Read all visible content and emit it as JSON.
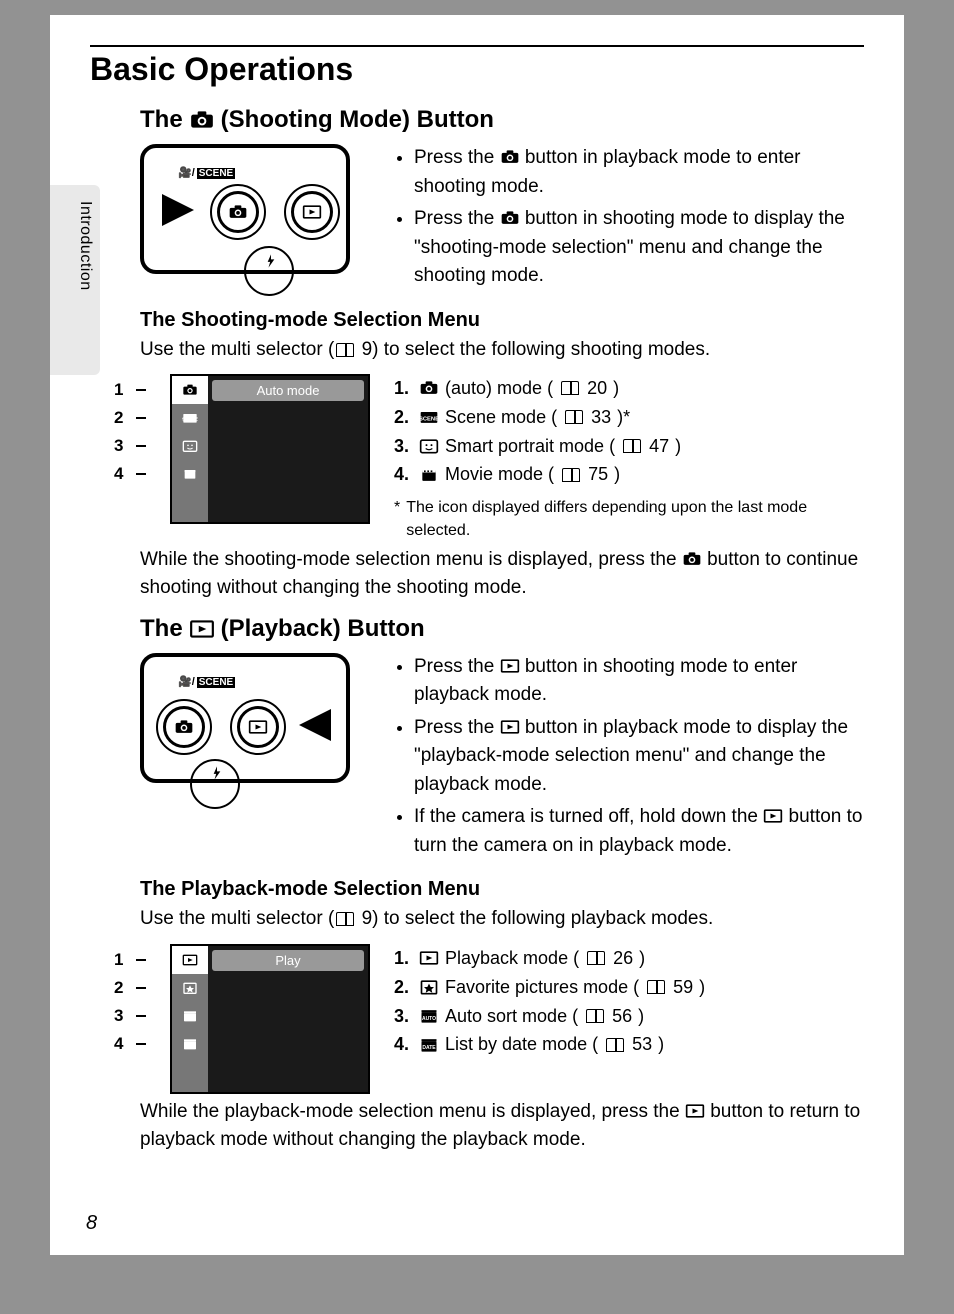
{
  "sideTab": "Introduction",
  "pageTitle": "Basic Operations",
  "section1": {
    "heading_pre": "The",
    "heading_post": "(Shooting Mode) Button",
    "bullets": [
      {
        "pre": "Press the ",
        "post": " button in playback mode to enter shooting mode."
      },
      {
        "pre": "Press the ",
        "post": " button in shooting mode to display the \"shooting-mode selection\" menu and change the shooting mode."
      }
    ],
    "subHeading": "The Shooting-mode Selection Menu",
    "intro_pre": "Use the multi selector (",
    "intro_ref": "9",
    "intro_post": ") to select the following shooting modes.",
    "menuHeader": "Auto mode",
    "modes": [
      {
        "n": "1.",
        "label": "(auto) mode (",
        "ref": "20",
        "suffix": ")"
      },
      {
        "n": "2.",
        "label": "Scene mode (",
        "ref": "33",
        "suffix": ")*"
      },
      {
        "n": "3.",
        "label": "Smart portrait mode (",
        "ref": "47",
        "suffix": ")"
      },
      {
        "n": "4.",
        "label": "Movie mode (",
        "ref": "75",
        "suffix": ")"
      }
    ],
    "footnote_star": "*",
    "footnote": "The icon displayed differs depending upon the last mode selected.",
    "outro_pre": "While the shooting-mode selection menu is displayed, press the ",
    "outro_post": " button to continue shooting without changing the shooting mode."
  },
  "section2": {
    "heading_pre": "The",
    "heading_post": "(Playback) Button",
    "bullets": [
      {
        "pre": "Press the ",
        "post": " button in shooting mode to enter playback mode."
      },
      {
        "pre": "Press the ",
        "post": " button in playback mode to display the \"playback-mode selection menu\" and change the playback mode."
      },
      {
        "pre": "If the camera is turned off, hold down the ",
        "post": " button to turn the camera on in playback mode."
      }
    ],
    "subHeading": "The Playback-mode Selection Menu",
    "intro_pre": "Use the multi selector (",
    "intro_ref": "9",
    "intro_post": ") to select the following playback modes.",
    "menuHeader": "Play",
    "modes": [
      {
        "n": "1.",
        "label": "Playback mode (",
        "ref": "26",
        "suffix": ")"
      },
      {
        "n": "2.",
        "label": "Favorite pictures mode (",
        "ref": "59",
        "suffix": ")"
      },
      {
        "n": "3.",
        "label": "Auto sort mode (",
        "ref": "56",
        "suffix": ")"
      },
      {
        "n": "4.",
        "label": "List by date mode (",
        "ref": "53",
        "suffix": ")"
      }
    ],
    "outro_pre": "While the playback-mode selection menu is displayed, press the ",
    "outro_post": " button to return to playback mode without changing the playback mode."
  },
  "pageNumber": "8",
  "callouts": [
    "1",
    "2",
    "3",
    "4"
  ]
}
